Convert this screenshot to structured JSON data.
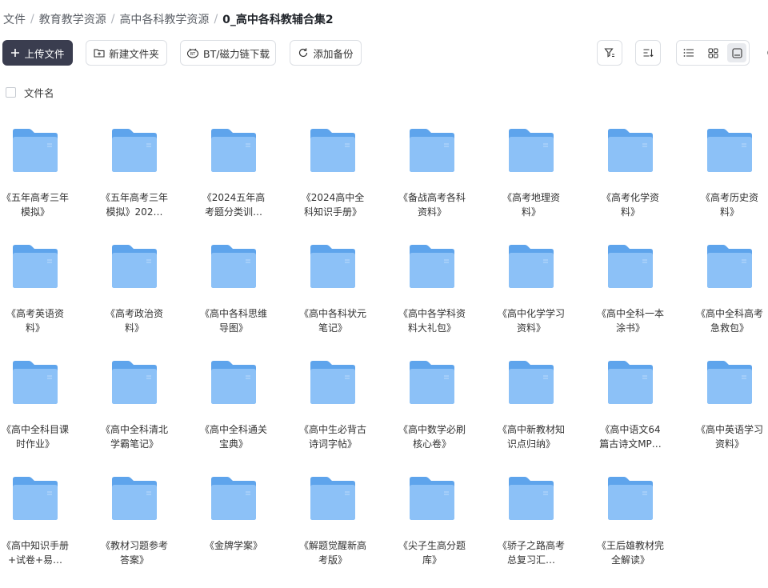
{
  "breadcrumb": {
    "items": [
      "文件",
      "教育教学资源",
      "高中各科教学资源"
    ],
    "current": "0_高中各科教辅合集2"
  },
  "toolbar": {
    "upload_label": "上传文件",
    "new_folder_label": "新建文件夹",
    "bt_label": "BT/磁力链下载",
    "backup_label": "添加备份"
  },
  "list_header": {
    "name_label": "文件名"
  },
  "folders": [
    "《五年高考三年模拟》",
    "《五年高考三年模拟》202…",
    "《2024五年高考题分类训…",
    "《2024高中全科知识手册》",
    "《备战高考各科资料》",
    "《高考地理资料》",
    "《高考化学资料》",
    "《高考历史资料》",
    "《高考英语资料》",
    "《高考政治资料》",
    "《高中各科思维导图》",
    "《高中各科状元笔记》",
    "《高中各学科资料大礼包》",
    "《高中化学学习资料》",
    "《高中全科一本涂书》",
    "《高中全科高考急救包》",
    "《高中全科目课时作业》",
    "《高中全科清北学霸笔记》",
    "《高中全科通关宝典》",
    "《高中生必背古诗词字帖》",
    "《高中数学必刷核心卷》",
    "《高中新教材知识点归纳》",
    "《高中语文64篇古诗文MP…",
    "《高中英语学习资料》",
    "《高中知识手册+试卷+易…",
    "《教材习题参考答案》",
    "《金牌学案》",
    "《解题觉醒新高考版》",
    "《尖子生高分题库》",
    "《骄子之路高考总复习汇…",
    "《王后雄教材完全解读》"
  ],
  "colors": {
    "folder_front": "#8cc1f7",
    "folder_back": "#5ea4ec",
    "primary_button": "#3a3d4f"
  }
}
